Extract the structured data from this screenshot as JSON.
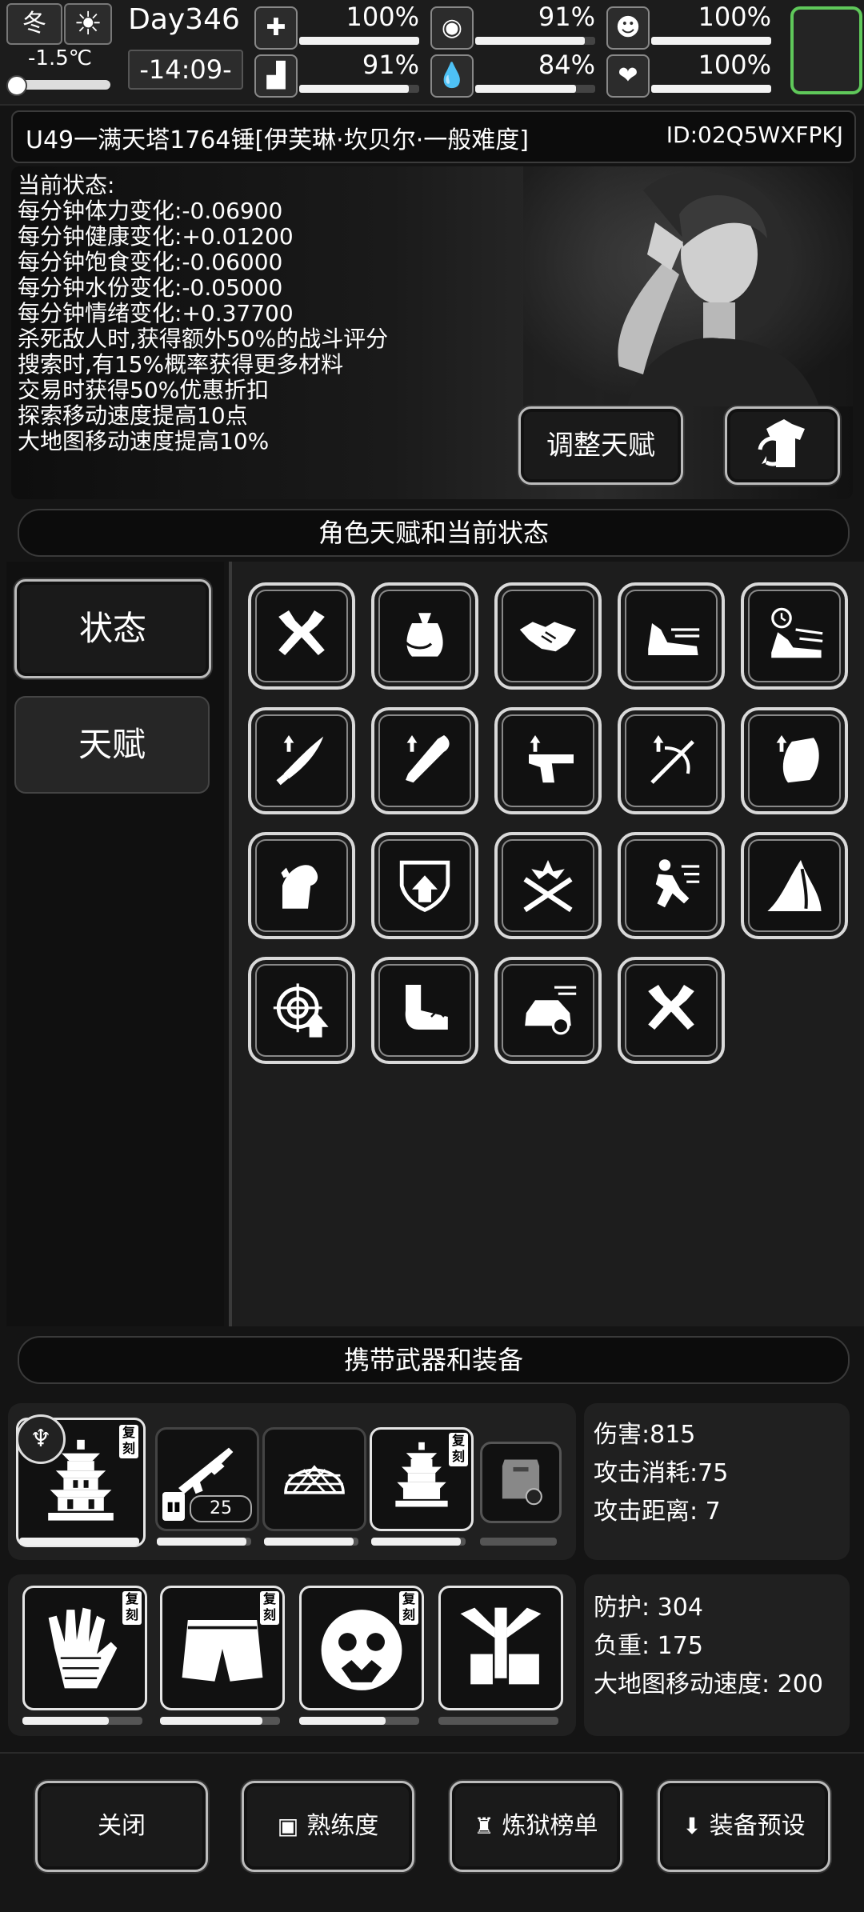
{
  "topbar": {
    "season": "冬",
    "weather_icon": "sun-icon",
    "temperature": "-1.5℃",
    "day": "Day346",
    "clock": "-14:09-",
    "stats": [
      {
        "icon": "medkit-icon",
        "glyph": "✚",
        "value": "100%",
        "level": 1.0
      },
      {
        "icon": "stomach-icon",
        "glyph": "◉",
        "value": "91%",
        "level": 0.91
      },
      {
        "icon": "mood-icon",
        "glyph": "☻",
        "value": "100%",
        "level": 1.0
      },
      {
        "icon": "boot-icon",
        "glyph": "▟",
        "value": "91%",
        "level": 0.91
      },
      {
        "icon": "water-drop-icon",
        "glyph": "💧",
        "value": "84%",
        "level": 0.84
      },
      {
        "icon": "heart-icon",
        "glyph": "❤",
        "value": "100%",
        "level": 1.0
      }
    ]
  },
  "title": {
    "text": "U49一满天塔1764锤[伊芙琳·坎贝尔·一般难度]",
    "id": "ID:02Q5WXFPKJ"
  },
  "status": {
    "heading": "当前状态:",
    "lines": [
      "每分钟体力变化:-0.06900",
      "每分钟健康变化:+0.01200",
      "每分钟饱食变化:-0.06000",
      "每分钟水份变化:-0.05000",
      "每分钟情绪变化:+0.37700",
      "杀死敌人时,获得额外50%的战斗评分",
      "搜索时,有15%概率获得更多材料",
      "交易时获得50%优惠折扣",
      "探索移动速度提高10点",
      "大地图移动速度提高10%"
    ],
    "adjust_button": "调整天赋",
    "swap_icon": "outfit-swap-icon"
  },
  "sections": {
    "talents_header": "角色天赋和当前状态",
    "equipment_header": "携带武器和装备"
  },
  "tabs": {
    "status": "状态",
    "talent": "天赋"
  },
  "talents": [
    "crossed-axes-icon",
    "loot-bag-icon",
    "handshake-icon",
    "running-shoe-icon",
    "speed-shoe-clock-icon",
    "machete-up-icon",
    "bat-up-icon",
    "pistol-up-icon",
    "crossbow-up-icon",
    "armor-pad-up-icon",
    "flexed-arm-icon",
    "shield-up-icon",
    "crossed-blades-blast-icon",
    "sprint-figure-icon",
    "road-icon",
    "target-up-icon",
    "arm-grab-icon",
    "speeding-car-icon",
    "crossed-axes-icon"
  ],
  "equipment": {
    "weapons": [
      {
        "icon": "pagoda-weapon-icon",
        "copy": "复刻",
        "durability": 1.0
      },
      {
        "icon": "assault-rifle-icon",
        "ammo": "25",
        "durability": 0.95
      },
      {
        "icon": "net-helmet-icon",
        "durability": 0.95
      },
      {
        "icon": "pagoda-weapon-icon",
        "copy": "复刻",
        "durability": 0.95
      },
      {
        "icon": "riot-shield-icon",
        "durability": 0.0
      }
    ],
    "weapon_badge_icon": "tribal-emblem-icon",
    "weapon_stats": {
      "damage": "伤害:815",
      "cost": "攻击消耗:75",
      "range": "攻击距离: 7"
    },
    "armor": [
      {
        "icon": "chain-gloves-icon",
        "copy": "复刻",
        "durability": 0.72
      },
      {
        "icon": "shorts-icon",
        "copy": "复刻",
        "durability": 0.85
      },
      {
        "icon": "beast-mask-icon",
        "copy": "复刻",
        "durability": 0.72
      },
      {
        "icon": "backpack-frame-icon",
        "durability": 0.0
      }
    ],
    "armor_stats": {
      "defense": "防护: 304",
      "load": "负重: 175",
      "map_speed": "大地图移动速度: 200"
    }
  },
  "bottom": {
    "close": "关闭",
    "proficiency": "熟练度",
    "ranking": "炼狱榜单",
    "preset": "装备预设"
  },
  "colors": {
    "accent_green": "#5fc85a",
    "panel": "#1d1d1d",
    "border": "#d9d9d9"
  }
}
